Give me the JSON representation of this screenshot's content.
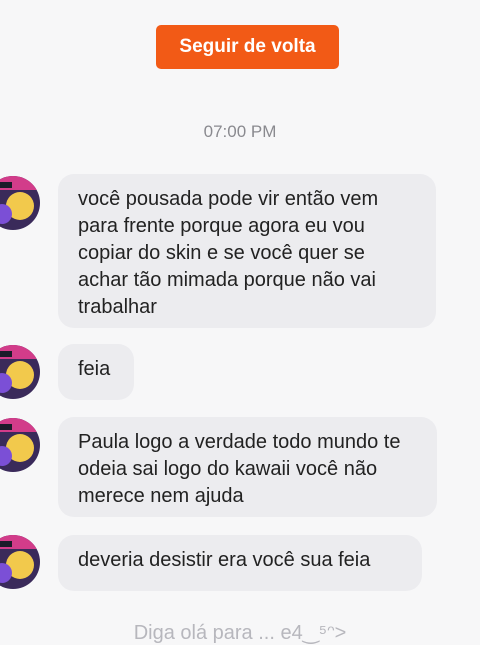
{
  "header": {
    "follow_back_label": "Seguir de volta"
  },
  "conversation": {
    "timestamp": "07:00 PM",
    "messages": [
      {
        "text": "você pousada pode vir então vem para frente porque agora eu vou copiar do skin e se você quer se achar tão mimada porque não vai trabalhar"
      },
      {
        "text": "feia"
      },
      {
        "text": "Paula logo a verdade todo mundo te odeia sai logo do kawaii você não merece nem ajuda"
      },
      {
        "text": "deveria desistir era você sua feia"
      }
    ]
  },
  "composer": {
    "placeholder": "Diga olá para ... e4‿⁵ᵔ>"
  },
  "colors": {
    "accent": "#f25a16",
    "bubble": "#ececef",
    "background": "#f7f7f8"
  },
  "avatar": {
    "icon": "avatar-icon"
  }
}
